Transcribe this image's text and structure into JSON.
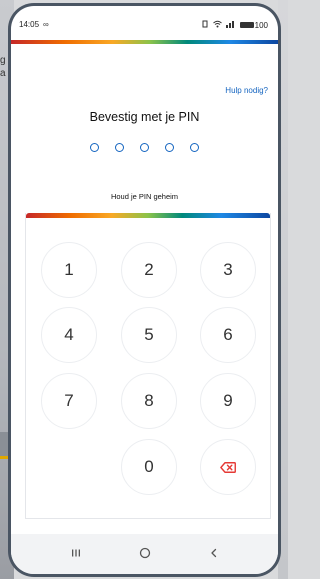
{
  "background": {
    "left_text": "g\na"
  },
  "status_bar": {
    "time": "14:05",
    "left_icon": "infinity-icon",
    "battery": "100",
    "icons": [
      "vibrate-icon",
      "wifi-icon",
      "signal-icon",
      "battery-icon"
    ]
  },
  "header": {
    "help_label": "Hulp nodig?"
  },
  "pin": {
    "title": "Bevestig met je PIN",
    "length": 5,
    "note": "Houd je PIN geheim"
  },
  "keypad": {
    "keys": [
      "1",
      "2",
      "3",
      "4",
      "5",
      "6",
      "7",
      "8",
      "9",
      "0"
    ],
    "delete_icon": "backspace-icon",
    "delete_color": "#e53935"
  },
  "navigation": {
    "recent_icon": "recent-apps-icon",
    "home_icon": "home-icon",
    "back_icon": "back-icon"
  },
  "colors": {
    "accent": "#1565c0",
    "frame": "#4a5563"
  }
}
